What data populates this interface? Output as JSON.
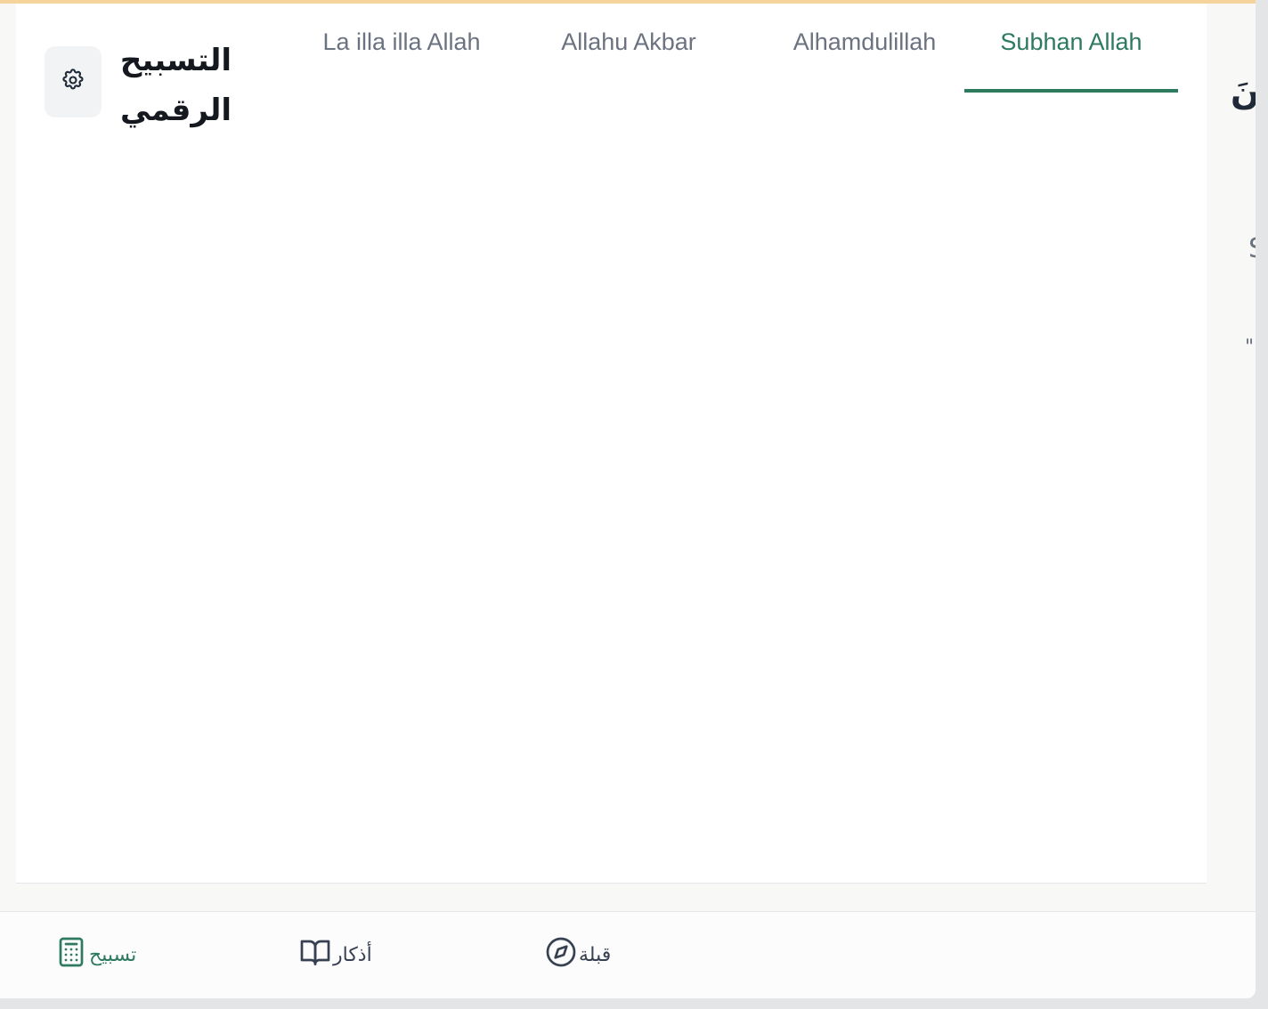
{
  "header": {
    "app_title": "التسبيح الرقمي",
    "settings_icon": "gear-icon"
  },
  "tabs": [
    {
      "label": "La illa illa Allah",
      "active": false
    },
    {
      "label": "Allahu Akbar",
      "active": false
    },
    {
      "label": "Alhamdulillah",
      "active": false
    },
    {
      "label": "Subhan Allah",
      "active": true
    }
  ],
  "peek": {
    "arabic_fragment": "نَ",
    "latin_fragment": "S",
    "quote_fragment": "\""
  },
  "bottom_nav": {
    "items": [
      {
        "label": "تسبيح",
        "icon": "calculator-icon",
        "active": true
      },
      {
        "label": "أذكار",
        "icon": "book-open-icon",
        "active": false
      },
      {
        "label": "قبلة",
        "icon": "compass-icon",
        "active": false
      }
    ]
  },
  "colors": {
    "accent": "#2d7a5f",
    "top_border": "#f6d39b",
    "muted_text": "#6b7280"
  }
}
